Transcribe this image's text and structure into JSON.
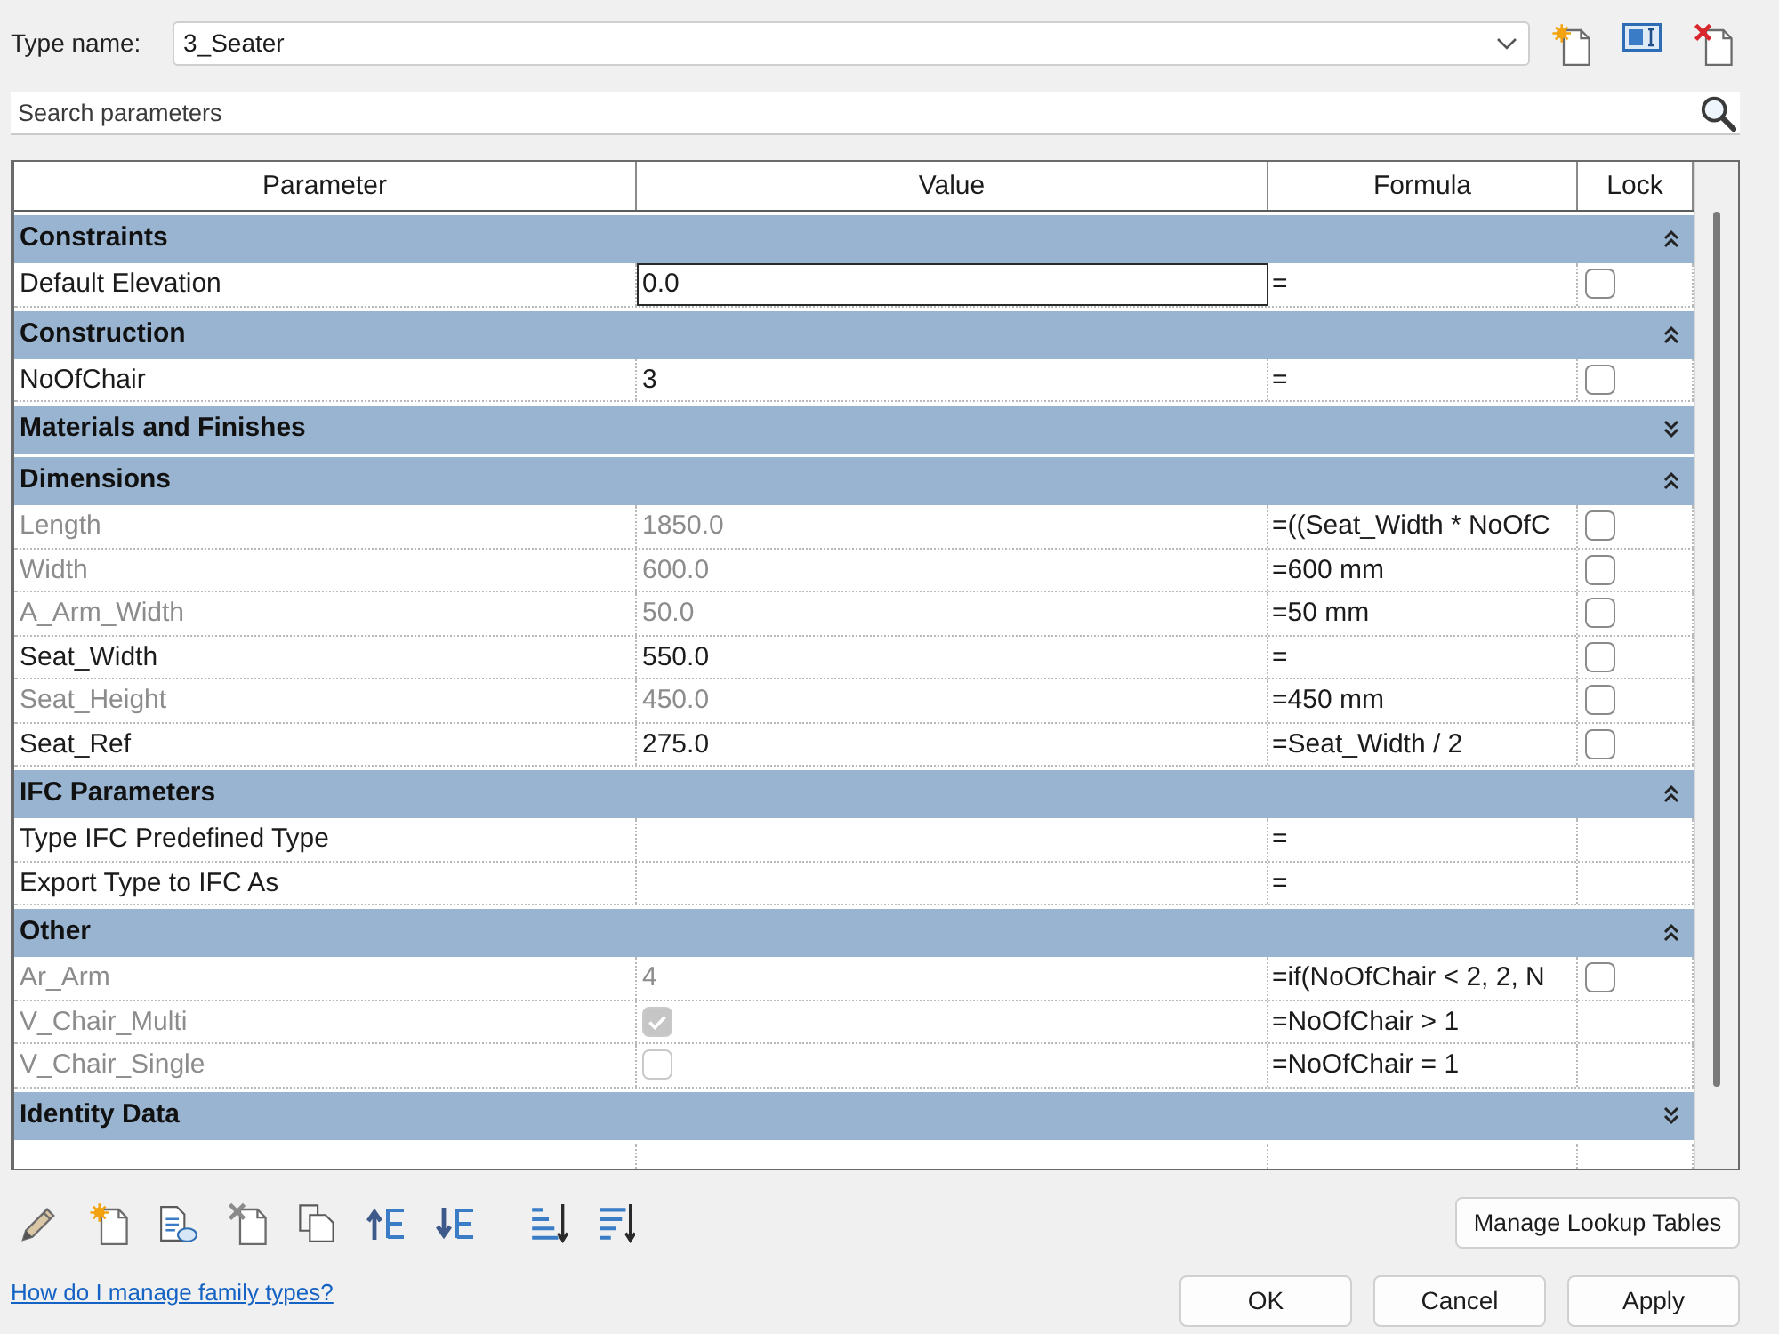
{
  "type_name": {
    "label": "Type name:",
    "value": "3_Seater"
  },
  "search": {
    "placeholder": "Search parameters"
  },
  "table": {
    "columns": [
      "Parameter",
      "Value",
      "Formula",
      "Lock"
    ],
    "groups": [
      {
        "title": "Constraints",
        "expanded": true,
        "rows": [
          {
            "parameter": "Default Elevation",
            "kind": "text",
            "value": "0.0",
            "formula": "=",
            "locked": false,
            "disabled": false,
            "editing": true
          }
        ]
      },
      {
        "title": "Construction",
        "expanded": true,
        "rows": [
          {
            "parameter": "NoOfChair",
            "kind": "text",
            "value": "3",
            "formula": "=",
            "locked": false,
            "disabled": false,
            "editing": false
          }
        ]
      },
      {
        "title": "Materials and Finishes",
        "expanded": false
      },
      {
        "title": "Dimensions",
        "expanded": true,
        "rows": [
          {
            "parameter": "Length",
            "kind": "text",
            "value": "1850.0",
            "formula": "=((Seat_Width * NoOfC",
            "locked": false,
            "disabled": true,
            "editing": false
          },
          {
            "parameter": "Width",
            "kind": "text",
            "value": "600.0",
            "formula": "=600 mm",
            "locked": false,
            "disabled": true,
            "editing": false
          },
          {
            "parameter": "A_Arm_Width",
            "kind": "text",
            "value": "50.0",
            "formula": "=50 mm",
            "locked": false,
            "disabled": true,
            "editing": false
          },
          {
            "parameter": "Seat_Width",
            "kind": "text",
            "value": "550.0",
            "formula": "=",
            "locked": false,
            "disabled": false,
            "editing": false
          },
          {
            "parameter": "Seat_Height",
            "kind": "text",
            "value": "450.0",
            "formula": "=450 mm",
            "locked": false,
            "disabled": true,
            "editing": false
          },
          {
            "parameter": "Seat_Ref",
            "kind": "text",
            "value": "275.0",
            "formula": "=Seat_Width / 2",
            "locked": false,
            "disabled": false,
            "editing": false
          }
        ]
      },
      {
        "title": "IFC Parameters",
        "expanded": true,
        "rows": [
          {
            "parameter": "Type IFC Predefined Type",
            "kind": "text",
            "formula": "=",
            "disabled": false
          },
          {
            "parameter": "Export Type to IFC As",
            "kind": "text",
            "formula": "=",
            "disabled": false
          }
        ]
      },
      {
        "title": "Other",
        "expanded": true,
        "rows": [
          {
            "parameter": "Ar_Arm",
            "kind": "text",
            "value": "4",
            "formula": "=if(NoOfChair < 2, 2, N",
            "locked": false,
            "disabled": true,
            "editing": false
          },
          {
            "parameter": "V_Chair_Multi",
            "kind": "checkbox",
            "checked": true,
            "formula": "=NoOfChair > 1",
            "disabled": true
          },
          {
            "parameter": "V_Chair_Single",
            "kind": "checkbox",
            "checked": false,
            "formula": "=NoOfChair = 1",
            "disabled": true
          }
        ]
      },
      {
        "title": "Identity Data",
        "expanded": false
      }
    ]
  },
  "manage_button": "Manage Lookup Tables",
  "help_link": "How do I manage family types?",
  "buttons": [
    "OK",
    "Cancel",
    "Apply"
  ]
}
